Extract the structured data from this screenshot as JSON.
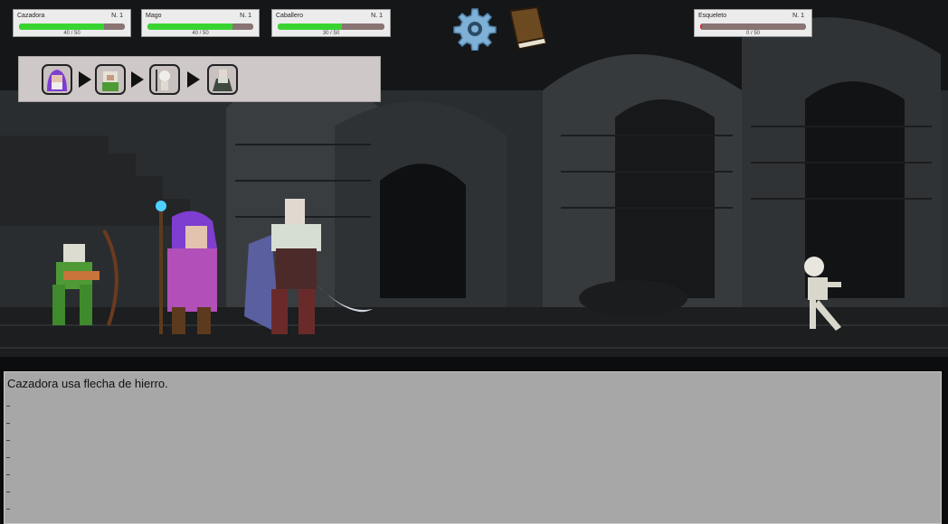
{
  "party": [
    {
      "name": "Cazadora",
      "level": "N. 1",
      "hp_text": "40 / 50",
      "hp_fraction": 0.8
    },
    {
      "name": "Mago",
      "level": "N. 1",
      "hp_text": "40 / 50",
      "hp_fraction": 0.8
    },
    {
      "name": "Caballero",
      "level": "N. 1",
      "hp_text": "30 / 50",
      "hp_fraction": 0.6
    }
  ],
  "enemies": [
    {
      "name": "Esqueleto",
      "level": "N. 1",
      "hp_text": "0 / 50",
      "hp_fraction": 0.02
    }
  ],
  "turn_order": [
    "mago-portrait-icon",
    "cazadora-portrait-icon",
    "esqueleto-portrait-icon",
    "caballero-portrait-icon"
  ],
  "toolbar": {
    "settings_icon": "gear-icon",
    "spellbook_icon": "book-icon"
  },
  "log": {
    "lines": [
      "Cazadora usa flecha de hierro."
    ]
  },
  "colors": {
    "hp_ally": "#39d431",
    "hp_enemy": "#e12b2b",
    "hp_empty": "#8a7373"
  }
}
